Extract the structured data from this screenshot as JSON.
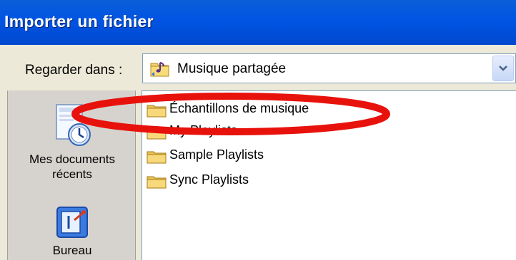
{
  "window": {
    "title": "Importer un fichier"
  },
  "look_in": {
    "label": "Regarder dans :",
    "value": "Musique partagée",
    "icon": "shared-music-folder-icon"
  },
  "places": [
    {
      "label_line1": "Mes documents",
      "label_line2": "récents",
      "icon": "recent-documents-icon"
    },
    {
      "label_line1": "Bureau",
      "icon": "desktop-icon"
    }
  ],
  "files": [
    {
      "name": "Échantillons de musique",
      "icon": "folder-icon"
    },
    {
      "name": "My Playlists",
      "icon": "folder-icon"
    },
    {
      "name": "Sample Playlists",
      "icon": "folder-icon"
    },
    {
      "name": "Sync Playlists",
      "icon": "folder-icon"
    }
  ],
  "colors": {
    "titlebar": "#0054e3",
    "dialog_bg": "#ece9d8",
    "highlight": "#e8120c"
  }
}
